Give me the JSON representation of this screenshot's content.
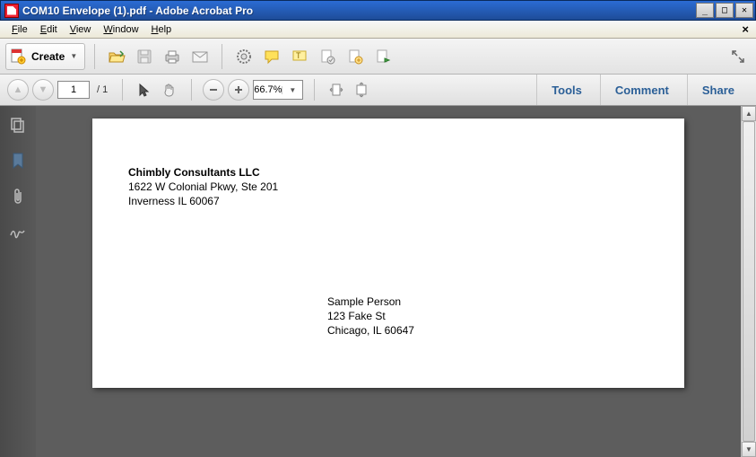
{
  "window": {
    "title": "COM10 Envelope (1).pdf - Adobe Acrobat Pro"
  },
  "menu": {
    "items": [
      "File",
      "Edit",
      "View",
      "Window",
      "Help"
    ]
  },
  "toolbar": {
    "create_label": "Create"
  },
  "nav": {
    "page_current": "1",
    "page_total": "/ 1",
    "zoom": "66.7%"
  },
  "panels": {
    "tools": "Tools",
    "comment": "Comment",
    "share": "Share"
  },
  "document": {
    "sender": {
      "name": "Chimbly Consultants LLC",
      "line1": "1622 W Colonial Pkwy, Ste 201",
      "line2": "Inverness IL 60067"
    },
    "recipient": {
      "name": "Sample Person",
      "line1": "123 Fake St",
      "line2": "Chicago, IL 60647"
    }
  }
}
